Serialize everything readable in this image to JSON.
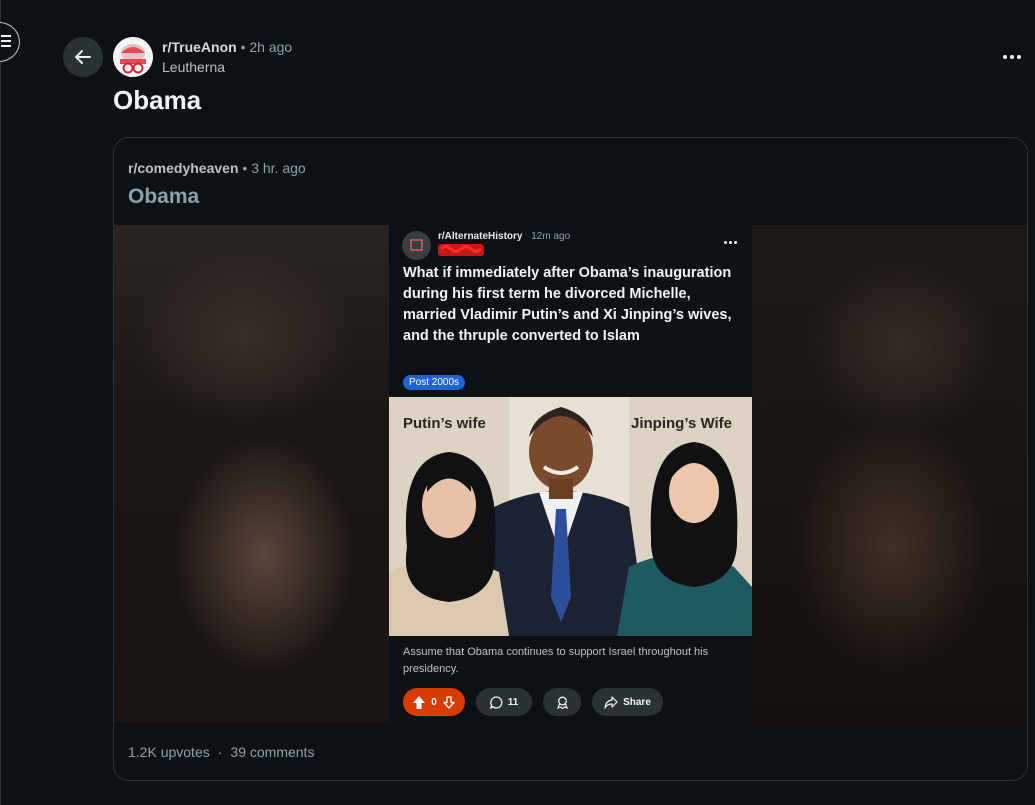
{
  "header": {
    "subreddit": "r/TrueAnon",
    "separator": "•",
    "time": "2h ago",
    "author": "Leutherna",
    "title": "Obama"
  },
  "crosspost": {
    "subreddit": "r/comedyheaven",
    "separator": "•",
    "time": "3 hr. ago",
    "title": "Obama",
    "upvotes": "1.2K upvotes",
    "stats_separator": "·",
    "comments": "39 comments"
  },
  "embedded_post": {
    "subreddit": "r/AlternateHistory",
    "time": "12m ago",
    "author": "redacted",
    "title": "What if immediately after Obama’s inauguration during his first term he divorced Michelle, married Vladimir Putin’s and Xi Jinping’s wives, and the thruple converted to Islam",
    "flair": "Post 2000s",
    "image_label_left": "Putin’s wife",
    "image_label_right": "Jinping’s Wife",
    "caption": "Assume that Obama continues to support Israel throughout his presidency.",
    "vote_count": "0",
    "comment_count": "11",
    "share_label": "Share"
  },
  "colors": {
    "background": "#0e1113",
    "upvote": "#d93a00",
    "flair": "#1f64d6",
    "muted": "#8ba2ad"
  },
  "icons": [
    "menu-icon",
    "back-arrow-icon",
    "more-icon",
    "upvote-icon",
    "downvote-icon",
    "comment-icon",
    "award-icon",
    "share-icon"
  ]
}
